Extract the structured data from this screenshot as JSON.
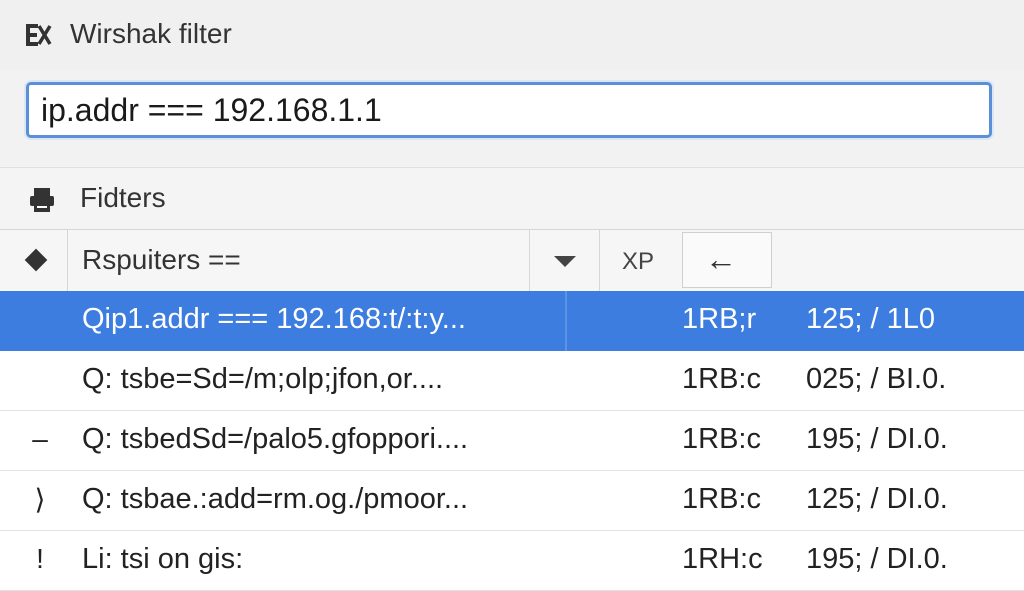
{
  "window": {
    "title": "Wirshak filter"
  },
  "filter_input": {
    "value": "ip.addr === 192.168.1.1"
  },
  "filters_bar": {
    "label": "Fidters"
  },
  "toolbar": {
    "combo_label": "Rspuiters ==",
    "xp_label": "XP",
    "back_label": "←"
  },
  "rows": [
    {
      "marker": "",
      "name": "Qip1.addr === 192.168:t/:t:y...",
      "col2": "1RB;r",
      "col3": "125; / 1L0"
    },
    {
      "marker": "",
      "name": "Q: tsbe=Sd=/m;olp;jfon,or....",
      "col2": "1RB:c",
      "col3": "025; / BI.0."
    },
    {
      "marker": "–",
      "name": "Q: tsbedSd=/palo5.gfoppori....",
      "col2": "1RB:c",
      "col3": "195; / DI.0."
    },
    {
      "marker": "⟩",
      "name": "Q: tsbae.:add=rm.og./pmoor...",
      "col2": "1RB:c",
      "col3": "125; / DI.0."
    },
    {
      "marker": "!",
      "name": "Li: tsi on gis:",
      "col2": "1RH:c",
      "col3": "195; / DI.0."
    }
  ],
  "colors": {
    "selected_row": "#3d7de0",
    "input_border": "#5b8fd6"
  },
  "icons": {
    "title": "app-logo-icon",
    "filters": "printer-icon",
    "toolbar_left": "diamond-icon",
    "dropdown": "chevron-down-icon",
    "back": "arrow-left-icon"
  }
}
